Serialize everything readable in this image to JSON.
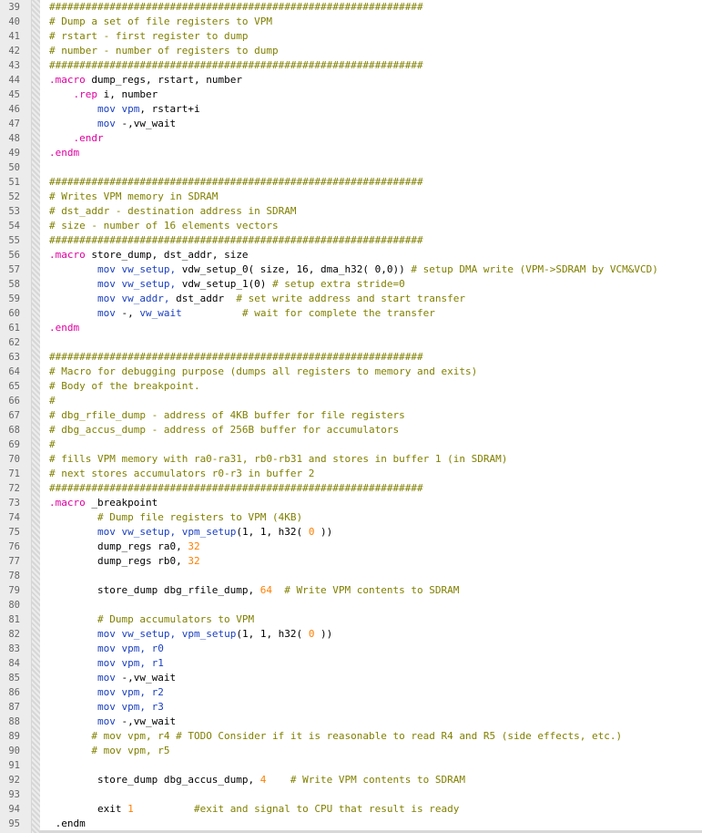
{
  "editor": {
    "colors": {
      "comment": "#808000",
      "directive": "#e000a0",
      "instruction": "#1a3fc0",
      "register": "#1a3fc0",
      "number": "#ff7f00",
      "plain": "#000000"
    },
    "lines": [
      {
        "n": "39",
        "tokens": [
          {
            "t": "comment",
            "s": "##############################################################"
          }
        ]
      },
      {
        "n": "40",
        "tokens": [
          {
            "t": "comment",
            "s": "# Dump a set of file registers to VPM"
          }
        ]
      },
      {
        "n": "41",
        "tokens": [
          {
            "t": "comment",
            "s": "# rstart - first register to dump"
          }
        ]
      },
      {
        "n": "42",
        "tokens": [
          {
            "t": "comment",
            "s": "# number - number of registers to dump"
          }
        ]
      },
      {
        "n": "43",
        "tokens": [
          {
            "t": "comment",
            "s": "##############################################################"
          }
        ]
      },
      {
        "n": "44",
        "tokens": [
          {
            "t": "directive",
            "s": ".macro"
          },
          {
            "t": "plain",
            "s": " dump_regs, rstart, number"
          }
        ]
      },
      {
        "n": "45",
        "tokens": [
          {
            "t": "plain",
            "s": "    "
          },
          {
            "t": "directive",
            "s": ".rep"
          },
          {
            "t": "plain",
            "s": " i, number"
          }
        ]
      },
      {
        "n": "46",
        "tokens": [
          {
            "t": "plain",
            "s": "        "
          },
          {
            "t": "instr",
            "s": "mov"
          },
          {
            "t": "plain",
            "s": " "
          },
          {
            "t": "reg",
            "s": "vpm"
          },
          {
            "t": "plain",
            "s": ", rstart+i"
          }
        ]
      },
      {
        "n": "47",
        "tokens": [
          {
            "t": "plain",
            "s": "        "
          },
          {
            "t": "instr",
            "s": "mov"
          },
          {
            "t": "plain",
            "s": " -,vw_wait"
          }
        ]
      },
      {
        "n": "48",
        "tokens": [
          {
            "t": "plain",
            "s": "    "
          },
          {
            "t": "directive",
            "s": ".endr"
          }
        ]
      },
      {
        "n": "49",
        "tokens": [
          {
            "t": "directive",
            "s": ".endm"
          }
        ]
      },
      {
        "n": "50",
        "tokens": []
      },
      {
        "n": "51",
        "tokens": [
          {
            "t": "comment",
            "s": "##############################################################"
          }
        ]
      },
      {
        "n": "52",
        "tokens": [
          {
            "t": "comment",
            "s": "# Writes VPM memory in SDRAM"
          }
        ]
      },
      {
        "n": "53",
        "tokens": [
          {
            "t": "comment",
            "s": "# dst_addr - destination address in SDRAM"
          }
        ]
      },
      {
        "n": "54",
        "tokens": [
          {
            "t": "comment",
            "s": "# size - number of 16 elements vectors"
          }
        ]
      },
      {
        "n": "55",
        "tokens": [
          {
            "t": "comment",
            "s": "##############################################################"
          }
        ]
      },
      {
        "n": "56",
        "tokens": [
          {
            "t": "directive",
            "s": ".macro"
          },
          {
            "t": "plain",
            "s": " store_dump, dst_addr, size"
          }
        ]
      },
      {
        "n": "57",
        "tokens": [
          {
            "t": "plain",
            "s": "        "
          },
          {
            "t": "instr",
            "s": "mov"
          },
          {
            "t": "plain",
            "s": " "
          },
          {
            "t": "reg",
            "s": "vw_setup,"
          },
          {
            "t": "plain",
            "s": " vdw_setup_0( size, 16, dma_h32( 0,0)) "
          },
          {
            "t": "comment",
            "s": "# setup DMA write (VPM->SDRAM by VCM&VCD)"
          }
        ]
      },
      {
        "n": "58",
        "tokens": [
          {
            "t": "plain",
            "s": "        "
          },
          {
            "t": "instr",
            "s": "mov"
          },
          {
            "t": "plain",
            "s": " "
          },
          {
            "t": "reg",
            "s": "vw_setup,"
          },
          {
            "t": "plain",
            "s": " vdw_setup_1(0) "
          },
          {
            "t": "comment",
            "s": "# setup extra stride=0"
          }
        ]
      },
      {
        "n": "59",
        "tokens": [
          {
            "t": "plain",
            "s": "        "
          },
          {
            "t": "instr",
            "s": "mov"
          },
          {
            "t": "plain",
            "s": " "
          },
          {
            "t": "reg",
            "s": "vw_addr,"
          },
          {
            "t": "plain",
            "s": " dst_addr  "
          },
          {
            "t": "comment",
            "s": "# set write address and start transfer"
          }
        ]
      },
      {
        "n": "60",
        "tokens": [
          {
            "t": "plain",
            "s": "        "
          },
          {
            "t": "instr",
            "s": "mov"
          },
          {
            "t": "plain",
            "s": " -, "
          },
          {
            "t": "reg",
            "s": "vw_wait"
          },
          {
            "t": "plain",
            "s": "          "
          },
          {
            "t": "comment",
            "s": "# wait for complete the transfer"
          }
        ]
      },
      {
        "n": "61",
        "tokens": [
          {
            "t": "directive",
            "s": ".endm"
          }
        ]
      },
      {
        "n": "62",
        "tokens": []
      },
      {
        "n": "63",
        "tokens": [
          {
            "t": "comment",
            "s": "##############################################################"
          }
        ]
      },
      {
        "n": "64",
        "tokens": [
          {
            "t": "comment",
            "s": "# Macro for debugging purpose (dumps all registers to memory and exits)"
          }
        ]
      },
      {
        "n": "65",
        "tokens": [
          {
            "t": "comment",
            "s": "# Body of the breakpoint."
          }
        ]
      },
      {
        "n": "66",
        "tokens": [
          {
            "t": "comment",
            "s": "#"
          }
        ]
      },
      {
        "n": "67",
        "tokens": [
          {
            "t": "comment",
            "s": "# dbg_rfile_dump - address of 4KB buffer for file registers"
          }
        ]
      },
      {
        "n": "68",
        "tokens": [
          {
            "t": "comment",
            "s": "# dbg_accus_dump - address of 256B buffer for accumulators"
          }
        ]
      },
      {
        "n": "69",
        "tokens": [
          {
            "t": "comment",
            "s": "#"
          }
        ]
      },
      {
        "n": "70",
        "tokens": [
          {
            "t": "comment",
            "s": "# fills VPM memory with ra0-ra31, rb0-rb31 and stores in buffer 1 (in SDRAM)"
          }
        ]
      },
      {
        "n": "71",
        "tokens": [
          {
            "t": "comment",
            "s": "# next stores accumulators r0-r3 in buffer 2"
          }
        ]
      },
      {
        "n": "72",
        "tokens": [
          {
            "t": "comment",
            "s": "##############################################################"
          }
        ]
      },
      {
        "n": "73",
        "tokens": [
          {
            "t": "directive",
            "s": ".macro"
          },
          {
            "t": "plain",
            "s": " _breakpoint"
          }
        ]
      },
      {
        "n": "74",
        "tokens": [
          {
            "t": "plain",
            "s": "        "
          },
          {
            "t": "comment",
            "s": "# Dump file registers to VPM (4KB)"
          }
        ]
      },
      {
        "n": "75",
        "tokens": [
          {
            "t": "plain",
            "s": "        "
          },
          {
            "t": "instr",
            "s": "mov"
          },
          {
            "t": "plain",
            "s": " "
          },
          {
            "t": "reg",
            "s": "vw_setup,"
          },
          {
            "t": "plain",
            "s": " "
          },
          {
            "t": "reg",
            "s": "vpm_setup"
          },
          {
            "t": "plain",
            "s": "(1, 1, h32( "
          },
          {
            "t": "number",
            "s": "0"
          },
          {
            "t": "plain",
            "s": " ))"
          }
        ]
      },
      {
        "n": "76",
        "tokens": [
          {
            "t": "plain",
            "s": "        dump_regs ra0, "
          },
          {
            "t": "number",
            "s": "32"
          }
        ]
      },
      {
        "n": "77",
        "tokens": [
          {
            "t": "plain",
            "s": "        dump_regs rb0, "
          },
          {
            "t": "number",
            "s": "32"
          }
        ]
      },
      {
        "n": "78",
        "tokens": []
      },
      {
        "n": "79",
        "tokens": [
          {
            "t": "plain",
            "s": "        store_dump dbg_rfile_dump, "
          },
          {
            "t": "number",
            "s": "64"
          },
          {
            "t": "plain",
            "s": "  "
          },
          {
            "t": "comment",
            "s": "# Write VPM contents to SDRAM"
          }
        ]
      },
      {
        "n": "80",
        "tokens": []
      },
      {
        "n": "81",
        "tokens": [
          {
            "t": "plain",
            "s": "        "
          },
          {
            "t": "comment",
            "s": "# Dump accumulators to VPM"
          }
        ]
      },
      {
        "n": "82",
        "tokens": [
          {
            "t": "plain",
            "s": "        "
          },
          {
            "t": "instr",
            "s": "mov"
          },
          {
            "t": "plain",
            "s": " "
          },
          {
            "t": "reg",
            "s": "vw_setup,"
          },
          {
            "t": "plain",
            "s": " "
          },
          {
            "t": "reg",
            "s": "vpm_setup"
          },
          {
            "t": "plain",
            "s": "(1, 1, h32( "
          },
          {
            "t": "number",
            "s": "0"
          },
          {
            "t": "plain",
            "s": " ))"
          }
        ]
      },
      {
        "n": "83",
        "tokens": [
          {
            "t": "plain",
            "s": "        "
          },
          {
            "t": "instr",
            "s": "mov"
          },
          {
            "t": "plain",
            "s": " "
          },
          {
            "t": "reg",
            "s": "vpm,"
          },
          {
            "t": "plain",
            "s": " "
          },
          {
            "t": "reg",
            "s": "r0"
          }
        ]
      },
      {
        "n": "84",
        "tokens": [
          {
            "t": "plain",
            "s": "        "
          },
          {
            "t": "instr",
            "s": "mov"
          },
          {
            "t": "plain",
            "s": " "
          },
          {
            "t": "reg",
            "s": "vpm,"
          },
          {
            "t": "plain",
            "s": " "
          },
          {
            "t": "reg",
            "s": "r1"
          }
        ]
      },
      {
        "n": "85",
        "tokens": [
          {
            "t": "plain",
            "s": "        "
          },
          {
            "t": "instr",
            "s": "mov"
          },
          {
            "t": "plain",
            "s": " -,vw_wait"
          }
        ]
      },
      {
        "n": "86",
        "tokens": [
          {
            "t": "plain",
            "s": "        "
          },
          {
            "t": "instr",
            "s": "mov"
          },
          {
            "t": "plain",
            "s": " "
          },
          {
            "t": "reg",
            "s": "vpm,"
          },
          {
            "t": "plain",
            "s": " "
          },
          {
            "t": "reg",
            "s": "r2"
          }
        ]
      },
      {
        "n": "87",
        "tokens": [
          {
            "t": "plain",
            "s": "        "
          },
          {
            "t": "instr",
            "s": "mov"
          },
          {
            "t": "plain",
            "s": " "
          },
          {
            "t": "reg",
            "s": "vpm,"
          },
          {
            "t": "plain",
            "s": " "
          },
          {
            "t": "reg",
            "s": "r3"
          }
        ]
      },
      {
        "n": "88",
        "tokens": [
          {
            "t": "plain",
            "s": "        "
          },
          {
            "t": "instr",
            "s": "mov"
          },
          {
            "t": "plain",
            "s": " -,vw_wait"
          }
        ]
      },
      {
        "n": "89",
        "tokens": [
          {
            "t": "plain",
            "s": "       "
          },
          {
            "t": "comment",
            "s": "# mov vpm, r4 # TODO Consider if it is reasonable to read R4 and R5 (side effects, etc.)"
          }
        ]
      },
      {
        "n": "90",
        "tokens": [
          {
            "t": "plain",
            "s": "       "
          },
          {
            "t": "comment",
            "s": "# mov vpm, r5"
          }
        ]
      },
      {
        "n": "91",
        "tokens": []
      },
      {
        "n": "92",
        "tokens": [
          {
            "t": "plain",
            "s": "        store_dump dbg_accus_dump, "
          },
          {
            "t": "number",
            "s": "4"
          },
          {
            "t": "plain",
            "s": "    "
          },
          {
            "t": "comment",
            "s": "# Write VPM contents to SDRAM"
          }
        ]
      },
      {
        "n": "93",
        "tokens": []
      },
      {
        "n": "94",
        "tokens": [
          {
            "t": "plain",
            "s": "        exit "
          },
          {
            "t": "number",
            "s": "1"
          },
          {
            "t": "plain",
            "s": "          "
          },
          {
            "t": "comment",
            "s": "#exit and signal to CPU that result is ready"
          }
        ]
      },
      {
        "n": "95",
        "tokens": [
          {
            "t": "plain",
            "s": " .endm"
          }
        ]
      }
    ]
  }
}
